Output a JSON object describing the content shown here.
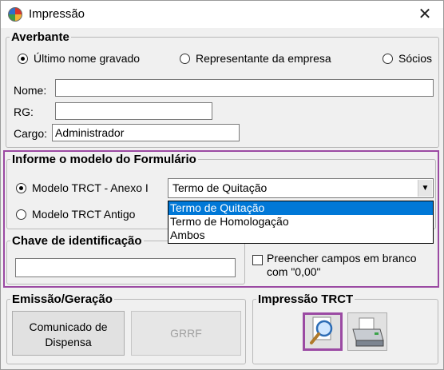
{
  "window": {
    "title": "Impressão",
    "close_symbol": "✕"
  },
  "averbante": {
    "legend": "Averbante",
    "options": [
      "Último nome gravado",
      "Representante da empresa",
      "Sócios"
    ],
    "selected_option": "Último nome gravado",
    "nome_label": "Nome:",
    "nome_value": "",
    "rg_label": "RG:",
    "rg_value": "",
    "cargo_label": "Cargo:",
    "cargo_value": "Administrador"
  },
  "formulario": {
    "legend": "Informe o modelo do Formulário",
    "option_1": "Modelo TRCT - Anexo I",
    "option_2": "Modelo TRCT Antigo",
    "selected_option": "Modelo TRCT - Anexo I",
    "combo_value": "Termo de Quitação",
    "dropdown_items": [
      "Termo de Quitação",
      "Termo de Homologação",
      "Ambos"
    ],
    "dropdown_selected": "Termo de Quitação"
  },
  "chave": {
    "legend": "Chave de identificação",
    "value": "",
    "checkbox_label_1": "Preencher campos em branco",
    "checkbox_label_2": "com \"0,00\"",
    "checked": false
  },
  "emissao": {
    "legend": "Emissão/Geração",
    "comunicado_line1": "Comunicado de",
    "comunicado_line2": "Dispensa",
    "grrf_label": "GRRF"
  },
  "impressao": {
    "legend": "Impressão TRCT",
    "preview_icon": "magnifier-icon",
    "print_icon": "printer-icon"
  },
  "colors": {
    "highlight": "#9b4aa3",
    "selection": "#0078d7"
  }
}
